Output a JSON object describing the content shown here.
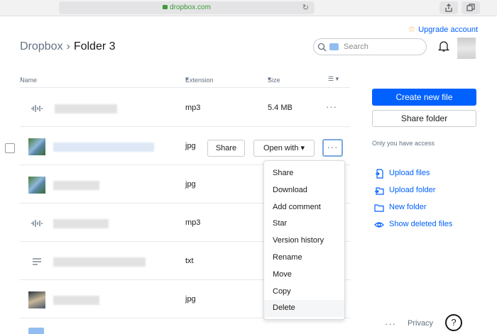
{
  "browser": {
    "url": "dropbox.com"
  },
  "header": {
    "upgrade_label": "Upgrade account",
    "breadcrumb_root": "Dropbox",
    "breadcrumb_sep": "›",
    "breadcrumb_current": "Folder 3",
    "search_placeholder": "Search"
  },
  "table": {
    "col_name": "Name",
    "col_extension": "Extension",
    "col_size": "Size",
    "rows": [
      {
        "ext": "mp3",
        "size": "5.4 MB",
        "icon": "audio-file-icon"
      },
      {
        "ext": "jpg",
        "size": "",
        "icon": "image-thumbnail"
      },
      {
        "ext": "jpg",
        "size": "",
        "icon": "image-thumbnail"
      },
      {
        "ext": "mp3",
        "size": "",
        "icon": "audio-file-icon"
      },
      {
        "ext": "txt",
        "size": "",
        "icon": "text-file-icon"
      },
      {
        "ext": "jpg",
        "size": "",
        "icon": "image-thumbnail"
      }
    ]
  },
  "row_actions": {
    "share_label": "Share",
    "open_with_label": "Open with",
    "more_label": "···"
  },
  "menu": {
    "items": [
      "Share",
      "Download",
      "Add comment",
      "Star",
      "Version history",
      "Rename",
      "Move",
      "Copy",
      "Delete"
    ],
    "highlighted": "Delete"
  },
  "sidebar": {
    "create_label": "Create new file",
    "share_folder_label": "Share folder",
    "access_text": "Only you have access",
    "actions": [
      "Upload files",
      "Upload folder",
      "New folder",
      "Show deleted files"
    ]
  },
  "footer": {
    "more_label": "···",
    "privacy_label": "Privacy",
    "help_label": "?"
  },
  "colors": {
    "accent": "#0061fe",
    "text": "#1e1919",
    "muted": "#637282"
  }
}
